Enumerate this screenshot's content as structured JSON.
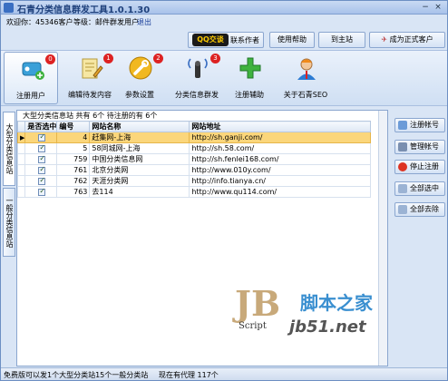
{
  "app": {
    "title": "石青分类信息群发工具1.0.1.30",
    "min": "−",
    "close": "×"
  },
  "info": {
    "welcome": "欢迎你：45346客户",
    "level": "等级：邮件群发用户",
    "logout": "退出"
  },
  "topbar": {
    "qq_label": "QQ交谈",
    "contact": "联系作者",
    "help": "使用帮助",
    "home": "到主站",
    "upgrade": "成为正式客户"
  },
  "tools": [
    {
      "label": "注册用户",
      "badge": "0",
      "icon": "register-user-icon"
    },
    {
      "label": "编辑待发内容",
      "badge": "1",
      "icon": "edit-content-icon"
    },
    {
      "label": "参数设置",
      "badge": "2",
      "icon": "settings-icon"
    },
    {
      "label": "分类信息群发",
      "badge": "3",
      "icon": "broadcast-icon"
    },
    {
      "label": "注册辅助",
      "badge": "",
      "icon": "plus-icon"
    },
    {
      "label": "关于石青SEO",
      "badge": "",
      "icon": "about-icon"
    }
  ],
  "vtabs": {
    "big": "大型分类信息站",
    "general": "一般分类信息站"
  },
  "panel": {
    "header": "大型分类信息站 共有 6个 待注册的有 6个"
  },
  "table": {
    "columns": [
      "是否选中",
      "编号",
      "网站名称",
      "网站地址"
    ],
    "rows": [
      {
        "id": "4",
        "name": "赶集网-上海",
        "url": "http://sh.ganji.com/",
        "selected": true
      },
      {
        "id": "5",
        "name": "58同城网-上海",
        "url": "http://sh.58.com/",
        "selected": false
      },
      {
        "id": "759",
        "name": "中国分类信息网",
        "url": "http://sh.fenlei168.com/",
        "selected": false
      },
      {
        "id": "761",
        "name": "北京分类网",
        "url": "http://www.010y.com/",
        "selected": false
      },
      {
        "id": "762",
        "name": "天涯分类网",
        "url": "http://info.tianya.cn/",
        "selected": false
      },
      {
        "id": "763",
        "name": "去114",
        "url": "http://www.qu114.com/",
        "selected": false
      }
    ]
  },
  "sidebar": {
    "register_account": "注册帐号",
    "manage_account": "管理帐号",
    "stop_register": "停止注册",
    "select_all": "全部选中",
    "deselect_all": "全部去除"
  },
  "status": {
    "left": "免费版可以发1个大型分类站15个一般分类站",
    "right": "现在有代理 117个"
  },
  "watermark": {
    "logo": "JB",
    "script": "Script",
    "cn": "脚本之家",
    "url": "jb51.net"
  }
}
